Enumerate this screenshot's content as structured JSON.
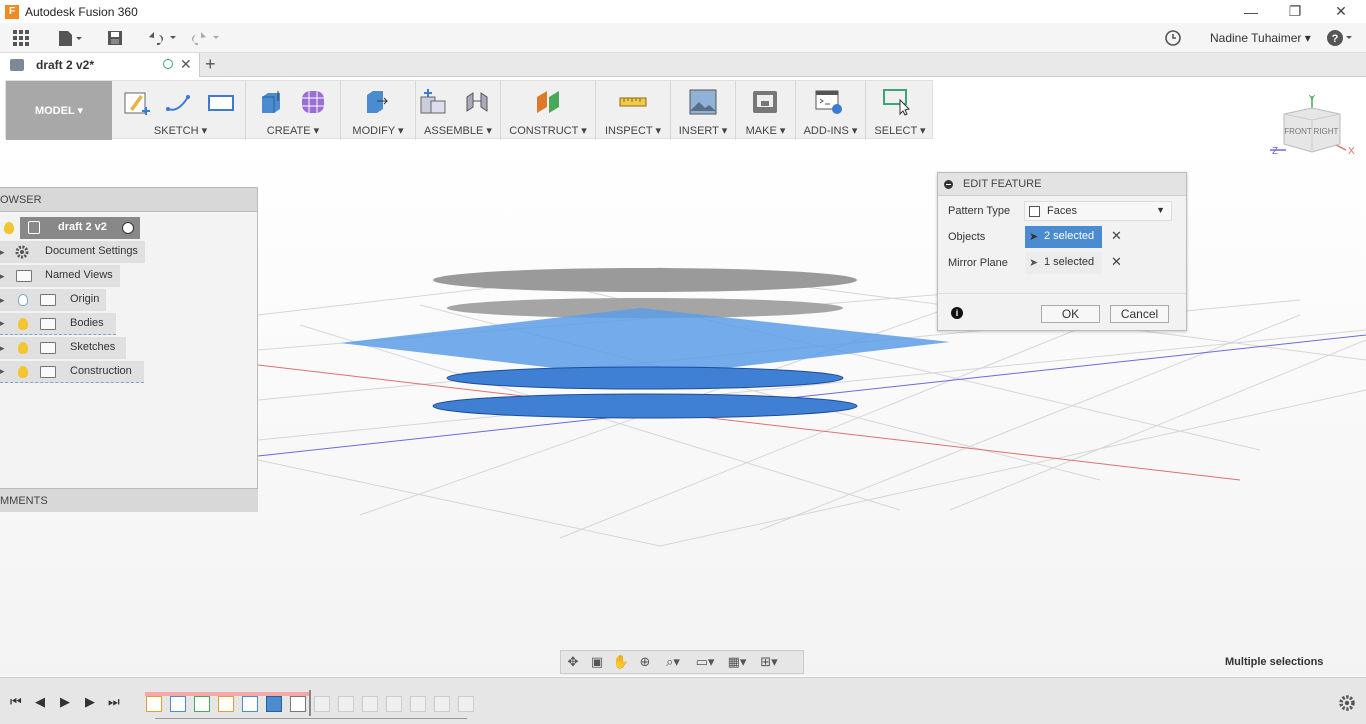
{
  "window": {
    "title": "Autodesk Fusion 360",
    "logo_letter": "F",
    "minimize": "—",
    "restore": "❐",
    "close": "✕"
  },
  "app_toolbar": {
    "user_name": "Nadine Tuhaimer",
    "help": "?"
  },
  "tab": {
    "name": "draft 2 v2*",
    "close": "✕",
    "add": "+"
  },
  "ribbon": {
    "mode": "MODEL ▾",
    "groups": [
      {
        "label": "SKETCH ▾"
      },
      {
        "label": "CREATE ▾"
      },
      {
        "label": "MODIFY ▾"
      },
      {
        "label": "ASSEMBLE ▾"
      },
      {
        "label": "CONSTRUCT ▾"
      },
      {
        "label": "INSPECT ▾"
      },
      {
        "label": "INSERT ▾"
      },
      {
        "label": "MAKE ▾"
      },
      {
        "label": "ADD-INS ▾"
      },
      {
        "label": "SELECT ▾"
      }
    ]
  },
  "browser": {
    "header": "OWSER",
    "root": "draft 2 v2",
    "items": [
      {
        "label": "Document Settings"
      },
      {
        "label": "Named Views"
      },
      {
        "label": "Origin"
      },
      {
        "label": "Bodies"
      },
      {
        "label": "Sketches"
      },
      {
        "label": "Construction"
      }
    ],
    "comments": "MMENTS"
  },
  "viewcube": {
    "front": "FRONT",
    "right": "RIGHT",
    "x": "X",
    "y": "Y",
    "z": "Z"
  },
  "edit_feature": {
    "title": "EDIT FEATURE",
    "pattern_type_label": "Pattern Type",
    "pattern_type_value": "Faces",
    "objects_label": "Objects",
    "objects_value": "2 selected",
    "mirror_plane_label": "Mirror Plane",
    "mirror_plane_value": "1 selected",
    "ok": "OK",
    "cancel": "Cancel"
  },
  "status": {
    "text": "Multiple selections"
  },
  "colors": {
    "accent_blue": "#3f86d1",
    "selected_field": "#4a8ccf",
    "model_tab": "#a8a8a8"
  }
}
